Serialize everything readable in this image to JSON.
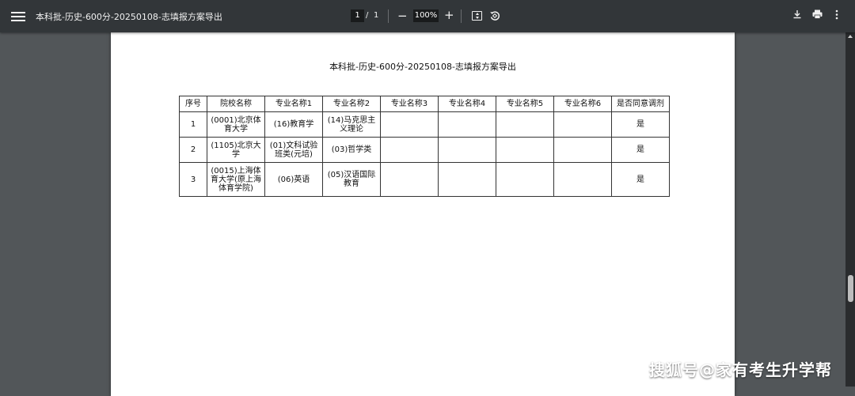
{
  "toolbar": {
    "title": "本科批-历史-600分-20250108-志填报方案导出",
    "page_current": "1",
    "page_separator": "/",
    "page_total": "1",
    "zoom": "100%",
    "zoom_out": "−",
    "zoom_in": "+"
  },
  "document": {
    "title": "本科批-历史-600分-20250108-志填报方案导出",
    "columns": [
      "序号",
      "院校名称",
      "专业名称1",
      "专业名称2",
      "专业名称3",
      "专业名称4",
      "专业名称5",
      "专业名称6",
      "是否同意调剂"
    ],
    "rows": [
      [
        "1",
        "(0001)北京体育大学",
        "(16)教育学",
        "(14)马克思主义理论",
        "",
        "",
        "",
        "",
        "是"
      ],
      [
        "2",
        "(1105)北京大学",
        "(01)文科试验班类(元培)",
        "(03)哲学类",
        "",
        "",
        "",
        "",
        "是"
      ],
      [
        "3",
        "(0015)上海体育大学(原上海体育学院)",
        "(06)英语",
        "(05)汉语国际教育",
        "",
        "",
        "",
        "",
        "是"
      ]
    ]
  },
  "watermark": "搜狐号@家有考生升学帮",
  "icons": {
    "menu": "hamburger-menu-icon",
    "fit": "fit-to-page-icon",
    "rotate": "rotate-icon",
    "download": "download-icon",
    "print": "print-icon",
    "more": "more-vert-icon"
  }
}
